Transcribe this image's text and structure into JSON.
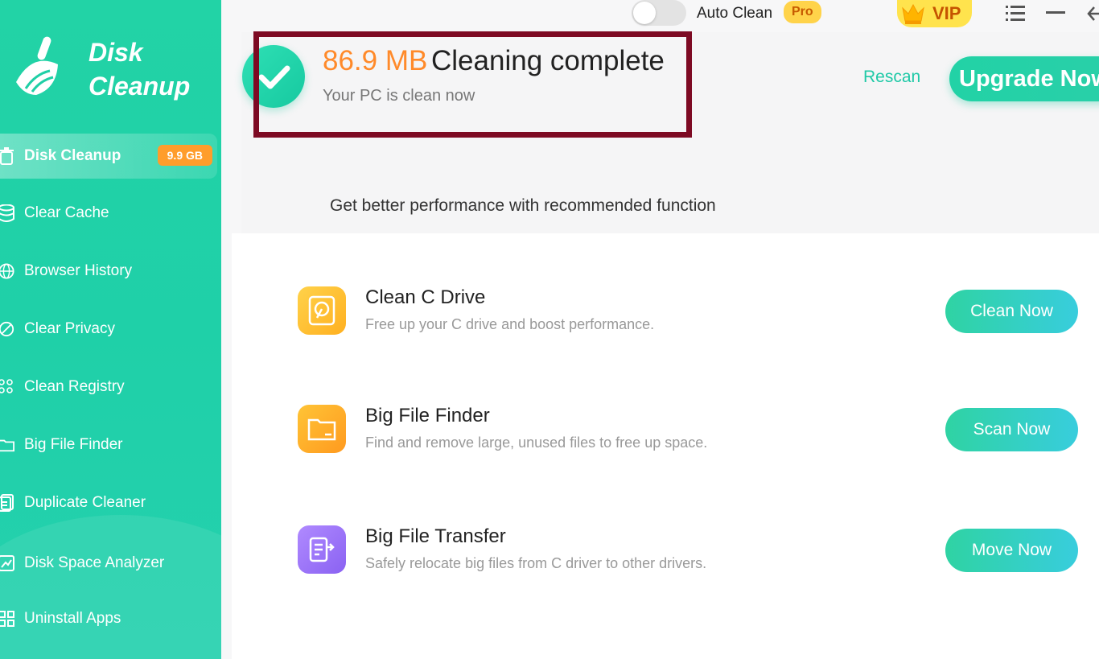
{
  "app": {
    "title_line1": "Disk",
    "title_line2": "Cleanup"
  },
  "sidebar": {
    "items": [
      {
        "label": "Disk Cleanup",
        "icon": "trash-icon",
        "badge": "9.9 GB",
        "active": true
      },
      {
        "label": "Clear Cache",
        "icon": "database-icon"
      },
      {
        "label": "Browser History",
        "icon": "globe-icon"
      },
      {
        "label": "Clear Privacy",
        "icon": "eye-slash-icon"
      },
      {
        "label": "Clean Registry",
        "icon": "grid-dots-icon"
      },
      {
        "label": "Big File Finder",
        "icon": "folder-icon"
      },
      {
        "label": "Duplicate Cleaner",
        "icon": "duplicate-icon"
      },
      {
        "label": "Disk Space Analyzer",
        "icon": "chart-icon"
      },
      {
        "label": "Uninstall Apps",
        "icon": "apps-icon"
      }
    ]
  },
  "topbar": {
    "auto_clean_label": "Auto Clean",
    "auto_clean_on": false,
    "pro_label": "Pro",
    "vip_label": "VIP"
  },
  "result": {
    "size": "86.9 MB",
    "title": "Cleaning complete",
    "subtitle": "Your PC is clean now",
    "rescan_label": "Rescan",
    "upgrade_label": "Upgrade Now"
  },
  "recommend": {
    "heading": "Get better performance with recommended function",
    "features": [
      {
        "title": "Clean C Drive",
        "desc": "Free up your C drive and boost performance.",
        "button": "Clean Now",
        "icon": "hard-drive-icon"
      },
      {
        "title": "Big File Finder",
        "desc": "Find and remove large, unused files to free up space.",
        "button": "Scan Now",
        "icon": "folder-icon"
      },
      {
        "title": "Big File Transfer",
        "desc": "Safely relocate big files from C driver to other drivers.",
        "button": "Move Now",
        "icon": "file-transfer-icon"
      }
    ]
  },
  "colors": {
    "accent": "#1fcfa6",
    "orange": "#ff8a2a",
    "highlight_border": "#7d0a23"
  }
}
